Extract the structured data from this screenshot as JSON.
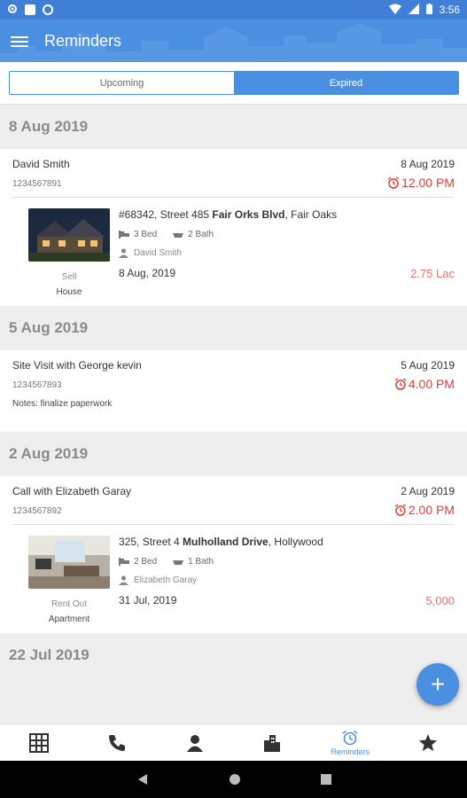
{
  "statusbar": {
    "time": "3:56",
    "icons": [
      "gear-icon",
      "sd-card-icon",
      "circle-icon",
      "wifi-icon",
      "signal-icon",
      "battery-icon"
    ]
  },
  "appbar": {
    "title": "Reminders",
    "menu_icon": "hamburger-icon"
  },
  "tabs": [
    {
      "label": "Upcoming",
      "active": false
    },
    {
      "label": "Expired",
      "active": true
    }
  ],
  "colors": {
    "accent": "#4a8fe0",
    "alert": "#e53935",
    "price": "#ef6c6c"
  },
  "groups": [
    {
      "date": "8 Aug 2019",
      "reminder": {
        "title": "David Smith",
        "phone": "1234567891",
        "date": "8 Aug 2019",
        "time": "12.00 PM",
        "property": {
          "address_prefix": "#68342, Street 485 ",
          "address_bold": "Fair Orks Blvd",
          "address_suffix": ", Fair Oaks",
          "beds": "3 Bed",
          "baths": "2 Bath",
          "agent": "David Smith",
          "listed": "8 Aug, 2019",
          "price": "2.75 Lac",
          "deal": "Sell",
          "type": "House"
        }
      }
    },
    {
      "date": "5 Aug 2019",
      "reminder": {
        "title": "Site Visit with George kevin",
        "phone": "1234567893",
        "notes": "Notes: finalize paperwork",
        "date": "5 Aug 2019",
        "time": "4.00 PM"
      }
    },
    {
      "date": "2 Aug 2019",
      "reminder": {
        "title": "Call with Elizabeth Garay",
        "phone": "1234567892",
        "date": "2 Aug 2019",
        "time": "2.00 PM",
        "property": {
          "address_prefix": "325, Street 4 ",
          "address_bold": "Mulholland Drive",
          "address_suffix": ", Hollywood",
          "beds": "2 Bed",
          "baths": "1 Bath",
          "agent": "Elizabeth Garay",
          "listed": "31 Jul, 2019",
          "price": "5,000",
          "deal": "Rent Out",
          "type": "Apartment"
        }
      }
    },
    {
      "date": "22 Jul 2019"
    }
  ],
  "bottom_nav": [
    {
      "icon": "grid-icon",
      "label": ""
    },
    {
      "icon": "phone-icon",
      "label": ""
    },
    {
      "icon": "person-icon",
      "label": ""
    },
    {
      "icon": "buildings-icon",
      "label": ""
    },
    {
      "icon": "alarm-icon",
      "label": "Reminders",
      "active": true
    },
    {
      "icon": "star-icon",
      "label": ""
    }
  ],
  "fab": {
    "label": "+"
  }
}
